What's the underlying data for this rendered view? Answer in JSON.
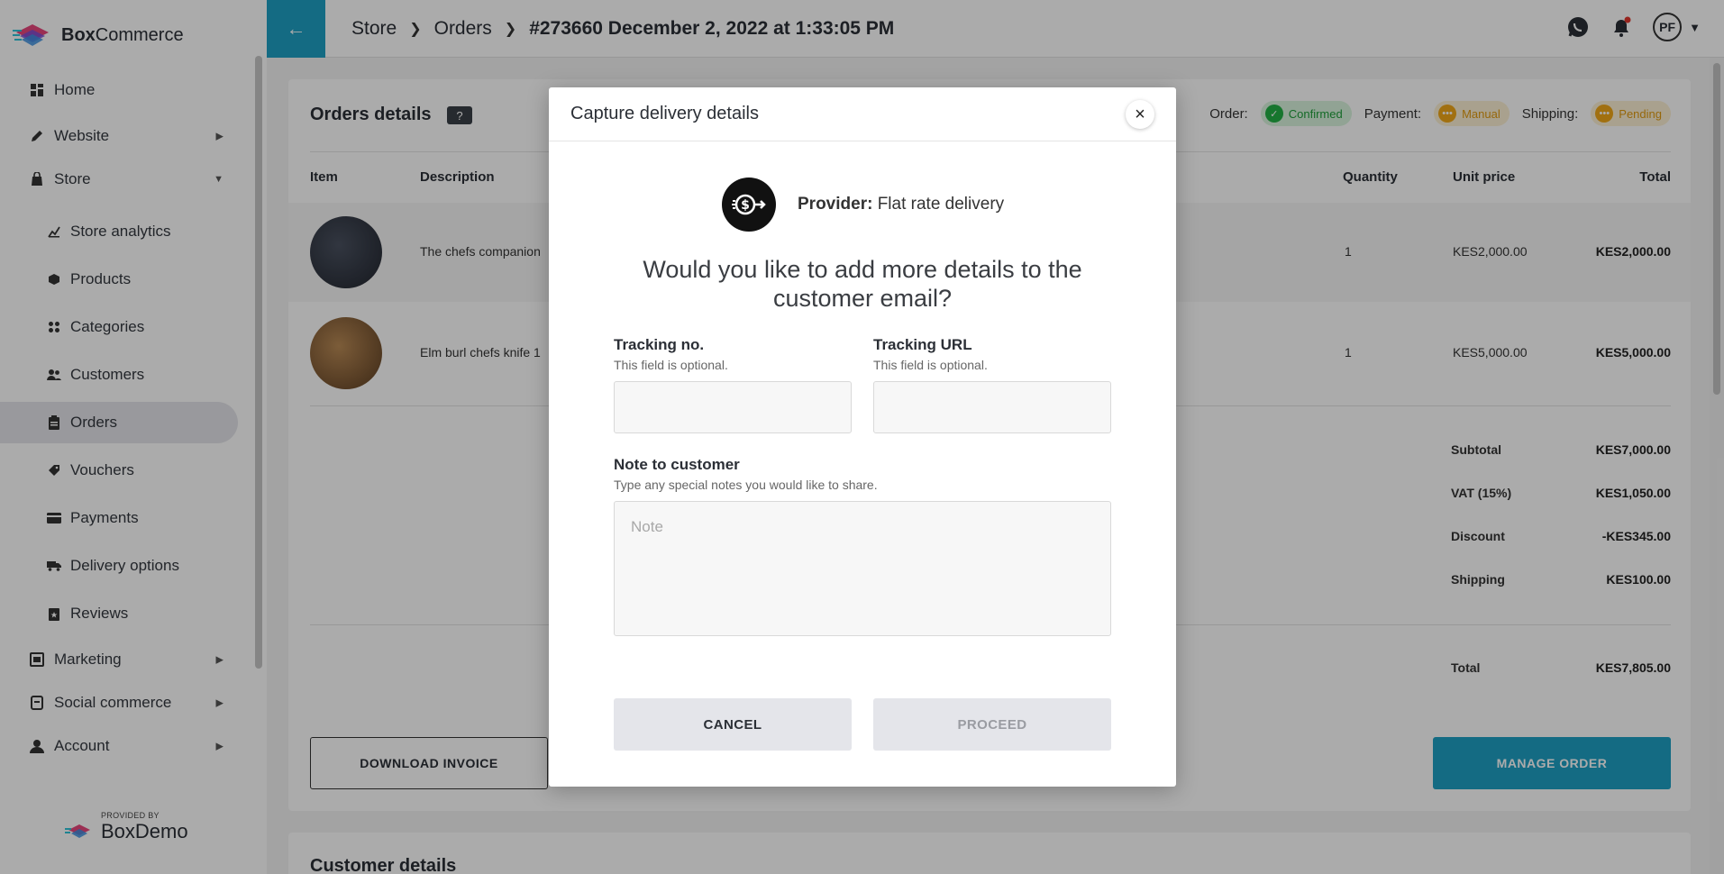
{
  "brand": {
    "logo_text_bold": "Box",
    "logo_text_rest": "Commerce"
  },
  "sidebar": {
    "items": [
      {
        "label": "Home"
      },
      {
        "label": "Website"
      },
      {
        "label": "Store"
      },
      {
        "label": "Store analytics"
      },
      {
        "label": "Products"
      },
      {
        "label": "Categories"
      },
      {
        "label": "Customers"
      },
      {
        "label": "Orders"
      },
      {
        "label": "Vouchers"
      },
      {
        "label": "Payments"
      },
      {
        "label": "Delivery options"
      },
      {
        "label": "Reviews"
      },
      {
        "label": "Marketing"
      },
      {
        "label": "Social commerce"
      },
      {
        "label": "Account"
      }
    ],
    "provided_by": "PROVIDED BY",
    "provider_brand": "BoxDemo"
  },
  "header": {
    "crumbs": [
      "Store",
      "Orders"
    ],
    "current": "#273660 December 2, 2022 at 1:33:05 PM",
    "avatar_initials": "PF"
  },
  "order": {
    "title": "Orders details",
    "help": "?",
    "status_labels": {
      "order": "Order:",
      "payment": "Payment:",
      "shipping": "Shipping:"
    },
    "statuses": {
      "order": "Confirmed",
      "payment": "Manual",
      "shipping": "Pending"
    },
    "columns": [
      "Item",
      "Description",
      "Quantity",
      "Unit price",
      "Total"
    ],
    "rows": [
      {
        "description": "The chefs companion",
        "quantity": "1",
        "unit_price": "KES2,000.00",
        "total": "KES2,000.00"
      },
      {
        "description": "Elm burl chefs knife 1",
        "quantity": "1",
        "unit_price": "KES5,000.00",
        "total": "KES5,000.00"
      }
    ],
    "summary": [
      {
        "label": "Subtotal",
        "value": "KES7,000.00"
      },
      {
        "label": "VAT (15%)",
        "value": "KES1,050.00"
      },
      {
        "label": "Discount",
        "value": "-KES345.00"
      },
      {
        "label": "Shipping",
        "value": "KES100.00"
      }
    ],
    "total": {
      "label": "Total",
      "value": "KES7,805.00"
    },
    "download_invoice": "DOWNLOAD INVOICE",
    "manage_order": "MANAGE ORDER"
  },
  "customer": {
    "title": "Customer details"
  },
  "modal": {
    "title": "Capture delivery details",
    "close": "×",
    "provider_label": "Provider:",
    "provider_value": "Flat rate delivery",
    "question": "Would you like to add more details to the customer email?",
    "tracking_no": {
      "label": "Tracking no.",
      "hint": "This field is optional.",
      "value": "",
      "placeholder": ""
    },
    "tracking_url": {
      "label": "Tracking URL",
      "hint": "This field is optional.",
      "value": "",
      "placeholder": ""
    },
    "note": {
      "label": "Note to customer",
      "hint": "Type any special notes you would like to share.",
      "placeholder": "Note"
    },
    "cancel": "CANCEL",
    "proceed": "PROCEED"
  },
  "colors": {
    "accent": "#1ea0c3",
    "confirmed": "#23b045",
    "pending": "#f0a818"
  }
}
